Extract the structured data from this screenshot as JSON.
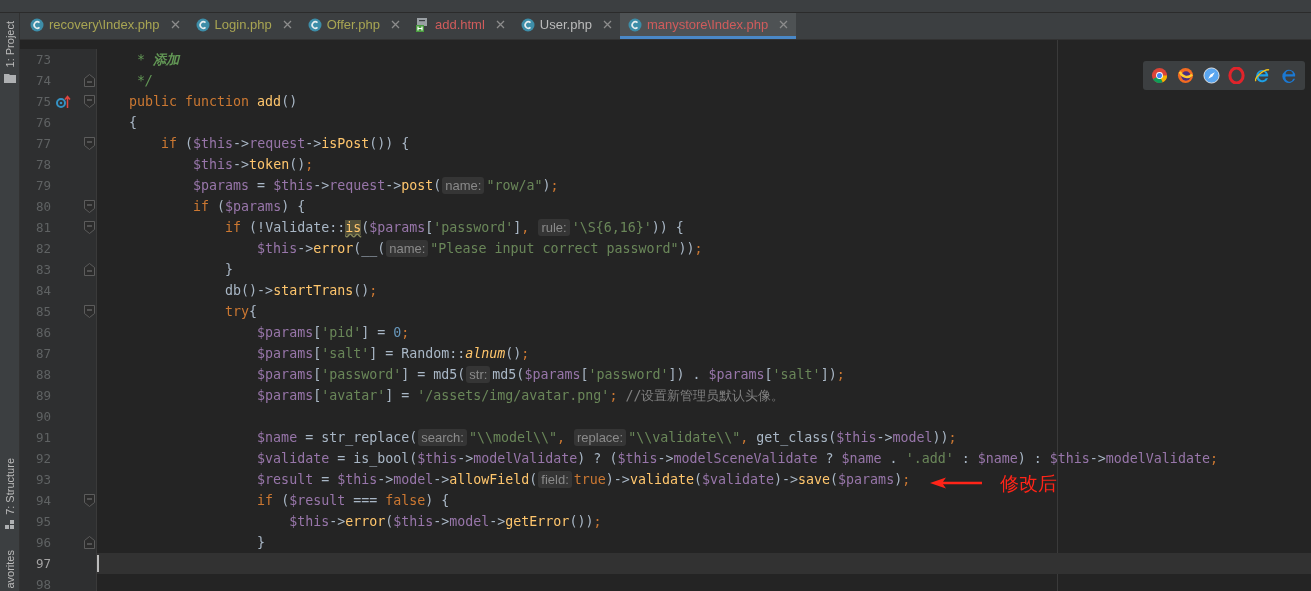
{
  "tool_windows_top": [
    {
      "label": "1: Project"
    }
  ],
  "tool_windows_bottom": [
    {
      "label": "7: Structure"
    },
    {
      "label": "avorites"
    }
  ],
  "tabs": [
    {
      "label": "recovery\\Index.php",
      "kind": "php",
      "color": "#a8a553",
      "selected": false
    },
    {
      "label": "Login.php",
      "kind": "php",
      "color": "#a8a553",
      "selected": false
    },
    {
      "label": "Offer.php",
      "kind": "php",
      "color": "#a8a553",
      "selected": false
    },
    {
      "label": "add.html",
      "kind": "html",
      "color": "#d15c5c",
      "selected": false
    },
    {
      "label": "User.php",
      "kind": "php",
      "color": "#bbbbbb",
      "selected": false
    },
    {
      "label": "manystore\\Index.php",
      "kind": "php",
      "color": "#d15c5c",
      "selected": true
    }
  ],
  "editor": {
    "lines": [
      {
        "number": "73",
        "fold_start": false,
        "fold_end": false,
        "marker": false,
        "current": false,
        "tokens": [
          {
            "kind": "doc",
            "text": "     * "
          },
          {
            "kind": "doctag",
            "text": "添加"
          }
        ]
      },
      {
        "number": "74",
        "fold_start": false,
        "fold_end": true,
        "marker": false,
        "current": false,
        "tokens": [
          {
            "kind": "doc",
            "text": "     */"
          }
        ]
      },
      {
        "number": "75",
        "fold_start": true,
        "fold_end": false,
        "marker": true,
        "current": false,
        "tokens": [
          {
            "kind": "kw",
            "text": "    public function "
          },
          {
            "kind": "fn",
            "text": "add"
          },
          {
            "kind": "plain",
            "text": "()"
          }
        ]
      },
      {
        "number": "76",
        "fold_start": false,
        "fold_end": false,
        "marker": false,
        "current": false,
        "tokens": [
          {
            "kind": "plain",
            "text": "    {"
          }
        ]
      },
      {
        "number": "77",
        "fold_start": true,
        "fold_end": false,
        "marker": false,
        "current": false,
        "tokens": [
          {
            "kind": "kw",
            "text": "        if"
          },
          {
            "kind": "plain",
            "text": " ("
          },
          {
            "kind": "var",
            "text": "$this"
          },
          {
            "kind": "plain",
            "text": "->"
          },
          {
            "kind": "var",
            "text": "request"
          },
          {
            "kind": "plain",
            "text": "->"
          },
          {
            "kind": "fn",
            "text": "isPost"
          },
          {
            "kind": "plain",
            "text": "()) {"
          }
        ]
      },
      {
        "number": "78",
        "fold_start": false,
        "fold_end": false,
        "marker": false,
        "current": false,
        "tokens": [
          {
            "kind": "var",
            "text": "            $this"
          },
          {
            "kind": "plain",
            "text": "->"
          },
          {
            "kind": "fn",
            "text": "token"
          },
          {
            "kind": "plain",
            "text": "()"
          },
          {
            "kind": "kw",
            "text": ";"
          }
        ]
      },
      {
        "number": "79",
        "fold_start": false,
        "fold_end": false,
        "marker": false,
        "current": false,
        "tokens": [
          {
            "kind": "var",
            "text": "            $params"
          },
          {
            "kind": "plain",
            "text": " = "
          },
          {
            "kind": "var",
            "text": "$this"
          },
          {
            "kind": "plain",
            "text": "->"
          },
          {
            "kind": "var",
            "text": "request"
          },
          {
            "kind": "plain",
            "text": "->"
          },
          {
            "kind": "fn",
            "text": "post"
          },
          {
            "kind": "plain",
            "text": "("
          },
          {
            "kind": "hint",
            "text": "name:"
          },
          {
            "kind": "str",
            "text": "\"row/a\""
          },
          {
            "kind": "plain",
            "text": ")"
          },
          {
            "kind": "kw",
            "text": ";"
          }
        ]
      },
      {
        "number": "80",
        "fold_start": true,
        "fold_end": false,
        "marker": false,
        "current": false,
        "tokens": [
          {
            "kind": "kw",
            "text": "            if"
          },
          {
            "kind": "plain",
            "text": " ("
          },
          {
            "kind": "var",
            "text": "$params"
          },
          {
            "kind": "plain",
            "text": ") {"
          }
        ]
      },
      {
        "number": "81",
        "fold_start": true,
        "fold_end": false,
        "marker": false,
        "current": false,
        "tokens": [
          {
            "kind": "kw",
            "text": "                if"
          },
          {
            "kind": "plain",
            "text": " (!Validate::"
          },
          {
            "kind": "warn",
            "text": "is"
          },
          {
            "kind": "plain",
            "text": "("
          },
          {
            "kind": "var",
            "text": "$params"
          },
          {
            "kind": "plain",
            "text": "["
          },
          {
            "kind": "str",
            "text": "'password'"
          },
          {
            "kind": "plain",
            "text": "]"
          },
          {
            "kind": "kw",
            "text": ", "
          },
          {
            "kind": "hint",
            "text": "rule:"
          },
          {
            "kind": "str",
            "text": "'\\S{6,16}'"
          },
          {
            "kind": "plain",
            "text": ")) {"
          }
        ]
      },
      {
        "number": "82",
        "fold_start": false,
        "fold_end": false,
        "marker": false,
        "current": false,
        "tokens": [
          {
            "kind": "var",
            "text": "                    $this"
          },
          {
            "kind": "plain",
            "text": "->"
          },
          {
            "kind": "fn",
            "text": "error"
          },
          {
            "kind": "plain",
            "text": "(__("
          },
          {
            "kind": "hint",
            "text": "name:"
          },
          {
            "kind": "str",
            "text": "\"Please input correct password\""
          },
          {
            "kind": "plain",
            "text": "))"
          },
          {
            "kind": "kw",
            "text": ";"
          }
        ]
      },
      {
        "number": "83",
        "fold_start": false,
        "fold_end": true,
        "marker": false,
        "current": false,
        "tokens": [
          {
            "kind": "plain",
            "text": "                }"
          }
        ]
      },
      {
        "number": "84",
        "fold_start": false,
        "fold_end": false,
        "marker": false,
        "current": false,
        "tokens": [
          {
            "kind": "plain",
            "text": "                db()->"
          },
          {
            "kind": "fn",
            "text": "startTrans"
          },
          {
            "kind": "plain",
            "text": "()"
          },
          {
            "kind": "kw",
            "text": ";"
          }
        ]
      },
      {
        "number": "85",
        "fold_start": true,
        "fold_end": false,
        "marker": false,
        "current": false,
        "tokens": [
          {
            "kind": "kw",
            "text": "                try"
          },
          {
            "kind": "plain",
            "text": "{"
          }
        ]
      },
      {
        "number": "86",
        "fold_start": false,
        "fold_end": false,
        "marker": false,
        "current": false,
        "tokens": [
          {
            "kind": "var",
            "text": "                    $params"
          },
          {
            "kind": "plain",
            "text": "["
          },
          {
            "kind": "str",
            "text": "'pid'"
          },
          {
            "kind": "plain",
            "text": "] = "
          },
          {
            "kind": "num",
            "text": "0"
          },
          {
            "kind": "kw",
            "text": ";"
          }
        ]
      },
      {
        "number": "87",
        "fold_start": false,
        "fold_end": false,
        "marker": false,
        "current": false,
        "tokens": [
          {
            "kind": "var",
            "text": "                    $params"
          },
          {
            "kind": "plain",
            "text": "["
          },
          {
            "kind": "str",
            "text": "'salt'"
          },
          {
            "kind": "plain",
            "text": "] = Random::"
          },
          {
            "kind": "static",
            "text": "alnum"
          },
          {
            "kind": "plain",
            "text": "()"
          },
          {
            "kind": "kw",
            "text": ";"
          }
        ]
      },
      {
        "number": "88",
        "fold_start": false,
        "fold_end": false,
        "marker": false,
        "current": false,
        "tokens": [
          {
            "kind": "var",
            "text": "                    $params"
          },
          {
            "kind": "plain",
            "text": "["
          },
          {
            "kind": "str",
            "text": "'password'"
          },
          {
            "kind": "plain",
            "text": "] = md5("
          },
          {
            "kind": "hint",
            "text": "str:"
          },
          {
            "kind": "plain",
            "text": "md5("
          },
          {
            "kind": "var",
            "text": "$params"
          },
          {
            "kind": "plain",
            "text": "["
          },
          {
            "kind": "str",
            "text": "'password'"
          },
          {
            "kind": "plain",
            "text": "]) . "
          },
          {
            "kind": "var",
            "text": "$params"
          },
          {
            "kind": "plain",
            "text": "["
          },
          {
            "kind": "str",
            "text": "'salt'"
          },
          {
            "kind": "plain",
            "text": "])"
          },
          {
            "kind": "kw",
            "text": ";"
          }
        ]
      },
      {
        "number": "89",
        "fold_start": false,
        "fold_end": false,
        "marker": false,
        "current": false,
        "tokens": [
          {
            "kind": "var",
            "text": "                    $params"
          },
          {
            "kind": "plain",
            "text": "["
          },
          {
            "kind": "str",
            "text": "'avatar'"
          },
          {
            "kind": "plain",
            "text": "] = "
          },
          {
            "kind": "str",
            "text": "'/assets/img/avatar.png'"
          },
          {
            "kind": "kw",
            "text": ";"
          },
          {
            "kind": "cmt",
            "text": " //设置新管理员默认头像。"
          }
        ]
      },
      {
        "number": "90",
        "fold_start": false,
        "fold_end": false,
        "marker": false,
        "current": false
      },
      {
        "number": "91",
        "fold_start": false,
        "fold_end": false,
        "marker": false,
        "current": false,
        "tokens": [
          {
            "kind": "var",
            "text": "                    $name"
          },
          {
            "kind": "plain",
            "text": " = str_replace("
          },
          {
            "kind": "hint",
            "text": "search:"
          },
          {
            "kind": "str",
            "text": "\"\\\\model\\\\\""
          },
          {
            "kind": "kw",
            "text": ", "
          },
          {
            "kind": "hint",
            "text": "replace:"
          },
          {
            "kind": "str",
            "text": "\"\\\\validate\\\\\""
          },
          {
            "kind": "kw",
            "text": ","
          },
          {
            "kind": "plain",
            "text": " get_class("
          },
          {
            "kind": "var",
            "text": "$this"
          },
          {
            "kind": "plain",
            "text": "->"
          },
          {
            "kind": "var",
            "text": "model"
          },
          {
            "kind": "plain",
            "text": "))"
          },
          {
            "kind": "kw",
            "text": ";"
          }
        ]
      },
      {
        "number": "92",
        "fold_start": false,
        "fold_end": false,
        "marker": false,
        "current": false,
        "tokens": [
          {
            "kind": "var",
            "text": "                    $validate"
          },
          {
            "kind": "plain",
            "text": " = is_bool("
          },
          {
            "kind": "var",
            "text": "$this"
          },
          {
            "kind": "plain",
            "text": "->"
          },
          {
            "kind": "var",
            "text": "modelValidate"
          },
          {
            "kind": "plain",
            "text": ") ? ("
          },
          {
            "kind": "var",
            "text": "$this"
          },
          {
            "kind": "plain",
            "text": "->"
          },
          {
            "kind": "var",
            "text": "modelSceneValidate"
          },
          {
            "kind": "plain",
            "text": " ? "
          },
          {
            "kind": "var",
            "text": "$name"
          },
          {
            "kind": "plain",
            "text": " . "
          },
          {
            "kind": "str",
            "text": "'.add'"
          },
          {
            "kind": "plain",
            "text": " : "
          },
          {
            "kind": "var",
            "text": "$name"
          },
          {
            "kind": "plain",
            "text": ") : "
          },
          {
            "kind": "var",
            "text": "$this"
          },
          {
            "kind": "plain",
            "text": "->"
          },
          {
            "kind": "var",
            "text": "modelValidate"
          },
          {
            "kind": "kw",
            "text": ";"
          }
        ]
      },
      {
        "number": "93",
        "fold_start": false,
        "fold_end": false,
        "marker": false,
        "current": false,
        "tokens": [
          {
            "kind": "var",
            "text": "                    $result"
          },
          {
            "kind": "plain",
            "text": " = "
          },
          {
            "kind": "var",
            "text": "$this"
          },
          {
            "kind": "plain",
            "text": "->"
          },
          {
            "kind": "var",
            "text": "model"
          },
          {
            "kind": "plain",
            "text": "->"
          },
          {
            "kind": "fn",
            "text": "allowField"
          },
          {
            "kind": "plain",
            "text": "("
          },
          {
            "kind": "hint",
            "text": "field:"
          },
          {
            "kind": "kw",
            "text": "true"
          },
          {
            "kind": "plain",
            "text": ")->"
          },
          {
            "kind": "fn",
            "text": "validate"
          },
          {
            "kind": "plain",
            "text": "("
          },
          {
            "kind": "var",
            "text": "$validate"
          },
          {
            "kind": "plain",
            "text": ")->"
          },
          {
            "kind": "fn",
            "text": "save"
          },
          {
            "kind": "plain",
            "text": "("
          },
          {
            "kind": "var",
            "text": "$params"
          },
          {
            "kind": "plain",
            "text": ")"
          },
          {
            "kind": "kw",
            "text": ";"
          }
        ]
      },
      {
        "number": "94",
        "fold_start": true,
        "fold_end": false,
        "marker": false,
        "current": false,
        "tokens": [
          {
            "kind": "kw",
            "text": "                    if"
          },
          {
            "kind": "plain",
            "text": " ("
          },
          {
            "kind": "var",
            "text": "$result"
          },
          {
            "kind": "plain",
            "text": " === "
          },
          {
            "kind": "kw",
            "text": "false"
          },
          {
            "kind": "plain",
            "text": ") {"
          }
        ]
      },
      {
        "number": "95",
        "fold_start": false,
        "fold_end": false,
        "marker": false,
        "current": false,
        "tokens": [
          {
            "kind": "var",
            "text": "                        $this"
          },
          {
            "kind": "plain",
            "text": "->"
          },
          {
            "kind": "fn",
            "text": "error"
          },
          {
            "kind": "plain",
            "text": "("
          },
          {
            "kind": "var",
            "text": "$this"
          },
          {
            "kind": "plain",
            "text": "->"
          },
          {
            "kind": "var",
            "text": "model"
          },
          {
            "kind": "plain",
            "text": "->"
          },
          {
            "kind": "fn",
            "text": "getError"
          },
          {
            "kind": "plain",
            "text": "())"
          },
          {
            "kind": "kw",
            "text": ";"
          }
        ]
      },
      {
        "number": "96",
        "fold_start": false,
        "fold_end": true,
        "marker": false,
        "current": false,
        "tokens": [
          {
            "kind": "plain",
            "text": "                    }"
          }
        ]
      },
      {
        "number": "97",
        "fold_start": false,
        "fold_end": false,
        "marker": false,
        "current": true
      },
      {
        "number": "98",
        "fold_start": false,
        "fold_end": false,
        "marker": false,
        "current": false
      }
    ]
  },
  "annotation": {
    "text": "修改后"
  }
}
